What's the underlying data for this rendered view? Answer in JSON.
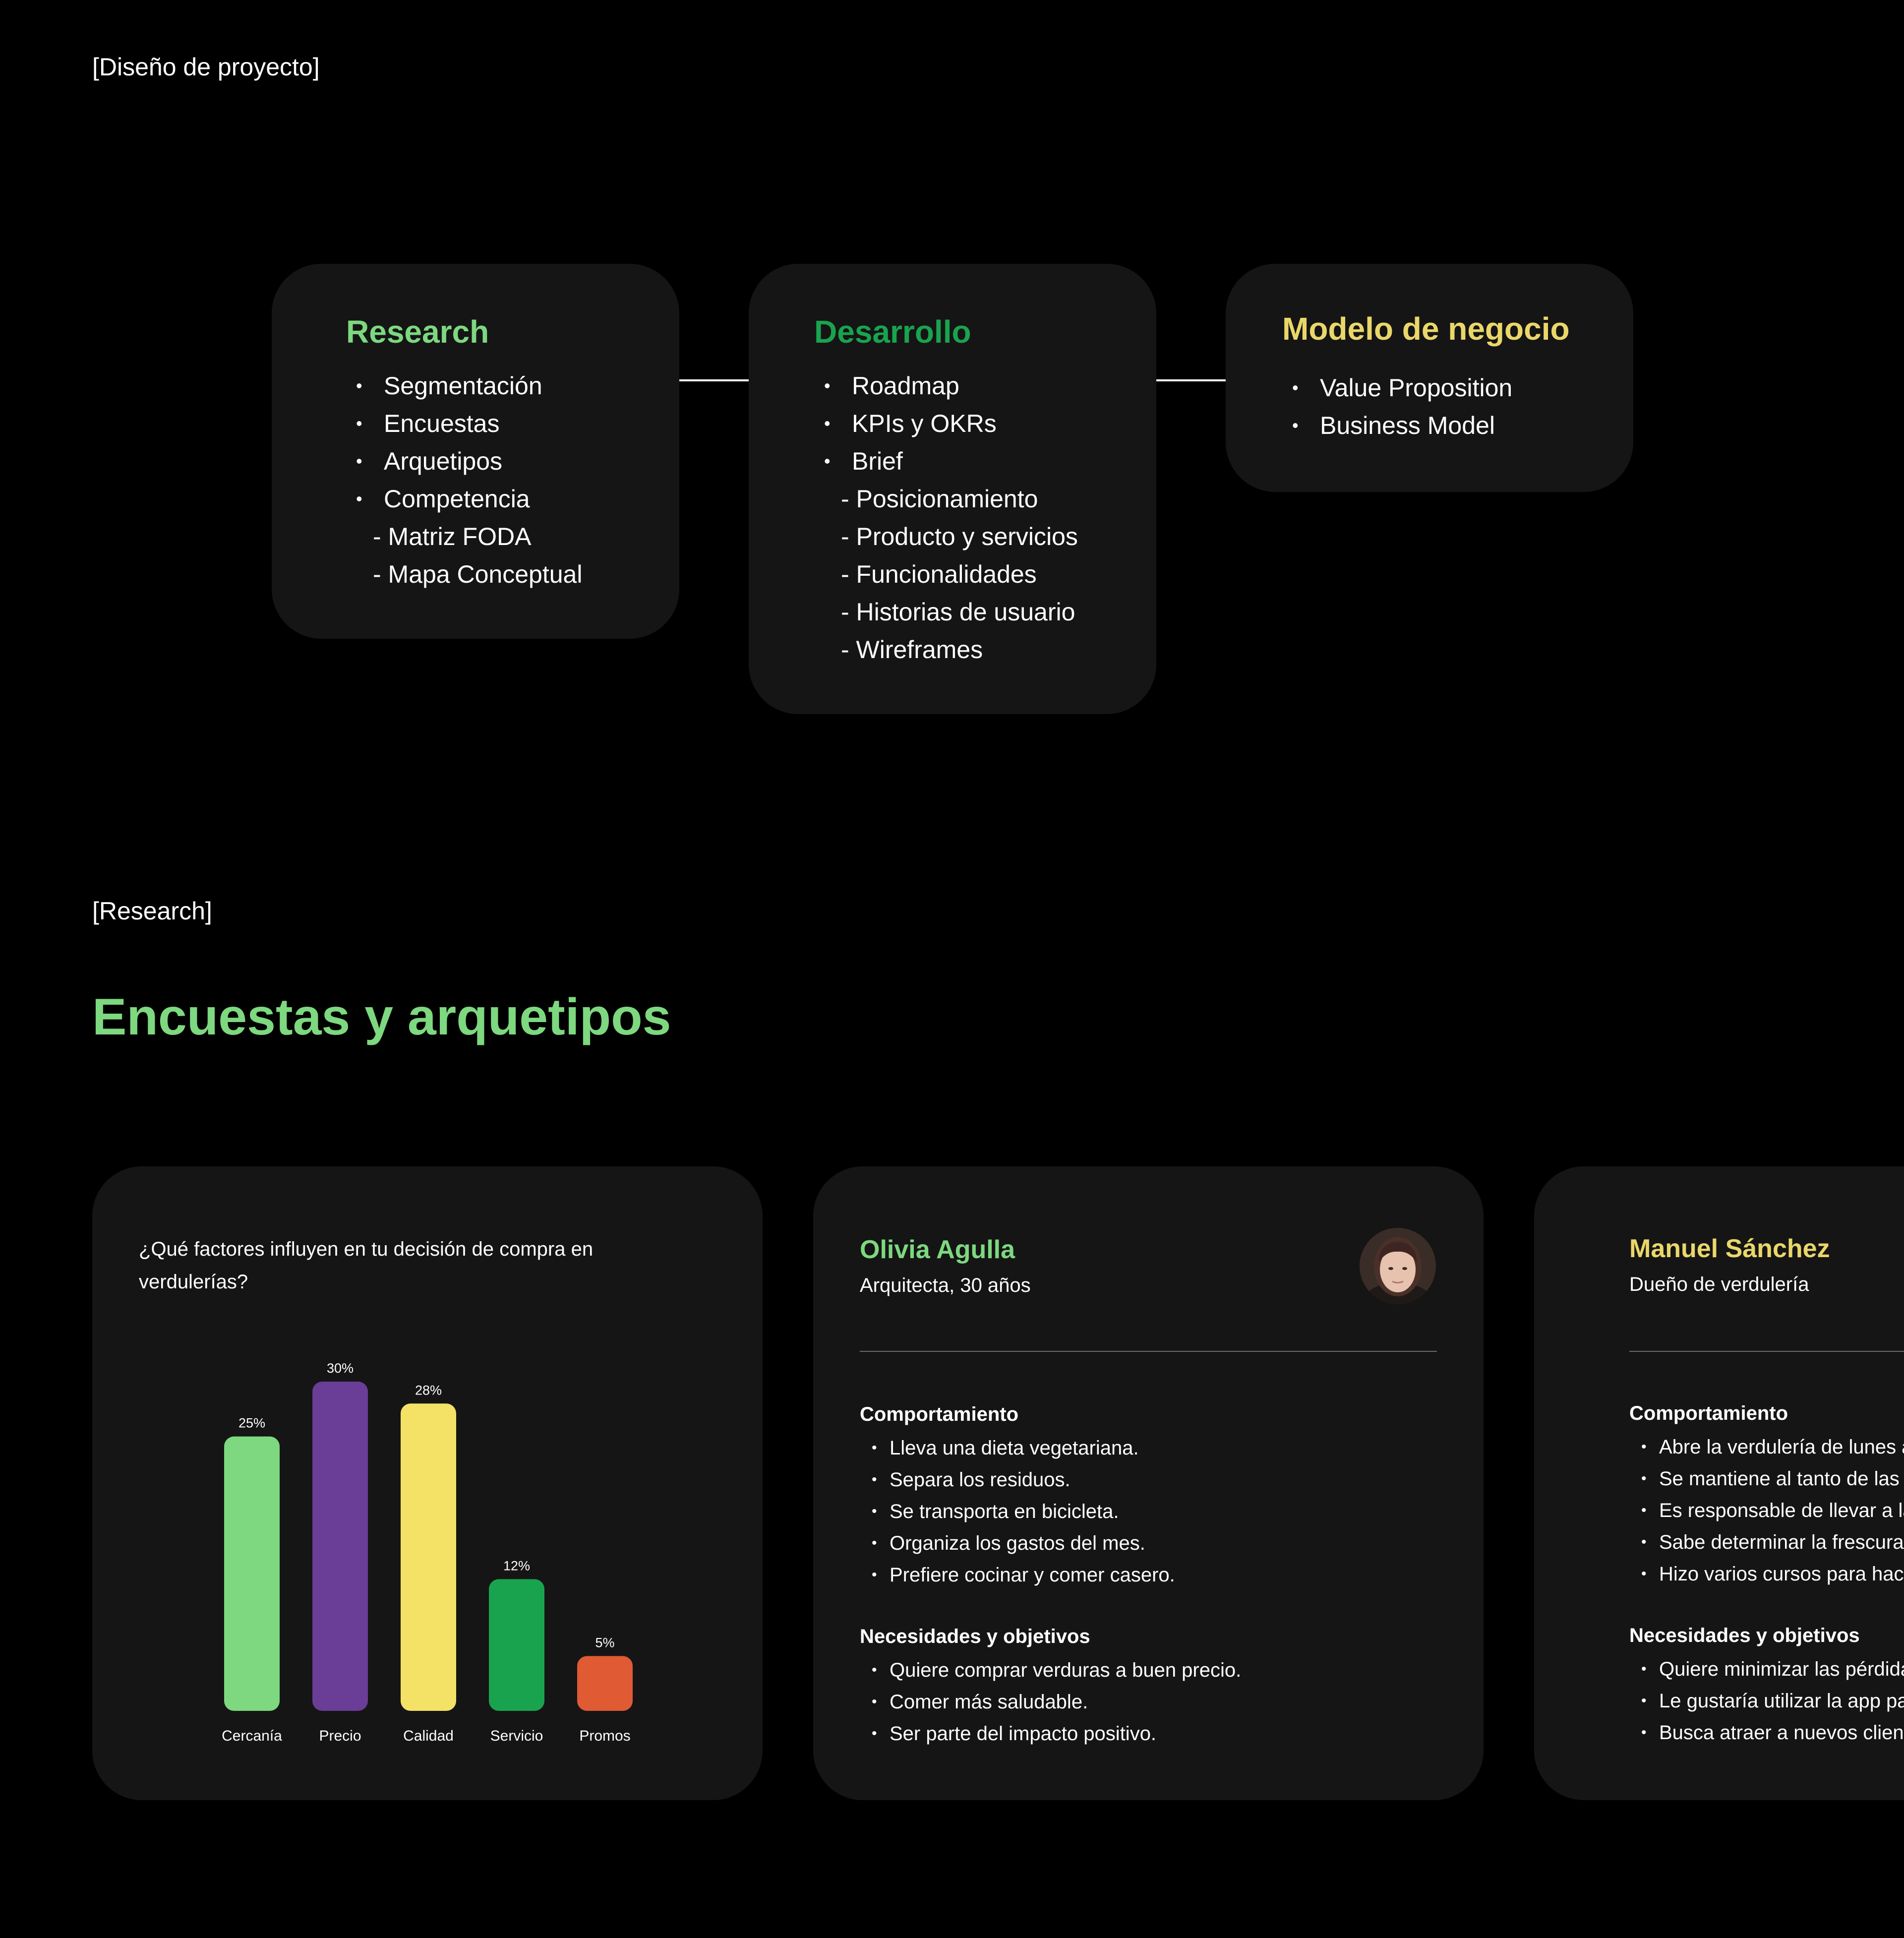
{
  "header": {
    "section_tag": "[Diseño de proyecto]"
  },
  "phases": [
    {
      "title": "Research",
      "color": "#7dd87f",
      "items": [
        {
          "text": "Segmentación",
          "level": 1
        },
        {
          "text": "Encuestas",
          "level": 1
        },
        {
          "text": "Arquetipos",
          "level": 1
        },
        {
          "text": "Competencia",
          "level": 1
        },
        {
          "text": "- Matriz FODA",
          "level": 2
        },
        {
          "text": "- Mapa Conceptual",
          "level": 2
        }
      ]
    },
    {
      "title": "Desarrollo",
      "color": "#1aa34f",
      "items": [
        {
          "text": "Roadmap",
          "level": 1
        },
        {
          "text": "KPIs y OKRs",
          "level": 1
        },
        {
          "text": "Brief",
          "level": 1
        },
        {
          "text": "- Posicionamiento",
          "level": 2
        },
        {
          "text": "- Producto y servicios",
          "level": 2
        },
        {
          "text": "- Funcionalidades",
          "level": 2
        },
        {
          "text": "- Historias de usuario",
          "level": 2
        },
        {
          "text": "- Wireframes",
          "level": 2
        }
      ]
    },
    {
      "title": "Modelo de negocio",
      "color": "#ead76a",
      "items": [
        {
          "text": "Value Proposition",
          "level": 1
        },
        {
          "text": "Business Model",
          "level": 1
        }
      ]
    }
  ],
  "research": {
    "section_tag": "[Research]",
    "title": "Encuestas y arquetipos",
    "title_color": "#7dd87f"
  },
  "survey": {
    "question": "¿Qué factores influyen en tu decisión de compra en verdulerías?"
  },
  "chart_data": {
    "type": "bar",
    "categories": [
      "Cercanía",
      "Precio",
      "Calidad",
      "Servicio",
      "Promos"
    ],
    "values": [
      25,
      30,
      28,
      12,
      5
    ],
    "data_labels": [
      "25%",
      "30%",
      "28%",
      "12%",
      "5%"
    ],
    "colors": [
      "#7dd87f",
      "#6a3d96",
      "#f3e265",
      "#1aa34f",
      "#e05a33"
    ],
    "title": "",
    "xlabel": "",
    "ylabel": "",
    "ylim": [
      0,
      30
    ],
    "grid": false
  },
  "personas": [
    {
      "name": "Olivia Agulla",
      "name_color": "#7dd87f",
      "role": "Arquitecta, 30 años",
      "behavior_title": "Comportamiento",
      "behavior": [
        "Lleva una dieta vegetariana.",
        "Separa los residuos.",
        "Se transporta en bicicleta.",
        "Organiza los gastos del mes.",
        "Prefiere cocinar y comer casero."
      ],
      "needs_title": "Necesidades y objetivos",
      "needs": [
        "Quiere comprar verduras a buen precio.",
        "Comer más saludable.",
        "Ser parte del impacto positivo."
      ]
    },
    {
      "name": "Manuel Sánchez",
      "name_color": "#ead76a",
      "role": "Dueño de verdulería",
      "behavior_title": "Comportamiento",
      "behavior": [
        "Abre la verdulería de lunes a",
        "Se mantiene al tanto de las",
        "Es responsable de llevar a la",
        "Sabe determinar la frescura",
        "Hizo varios cursos para hac"
      ],
      "needs_title": "Necesidades y objetivos",
      "needs": [
        "Quiere minimizar las pérdida",
        "Le gustaría utilizar la app pa",
        "Busca atraer a nuevos clien"
      ]
    }
  ]
}
